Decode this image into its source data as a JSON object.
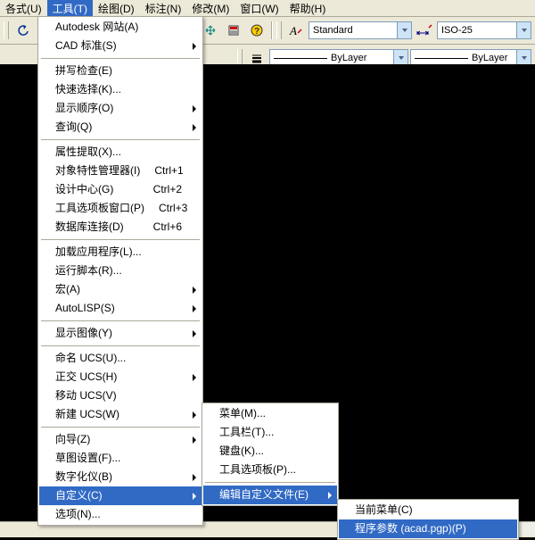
{
  "menubar": {
    "items": [
      "各式(U)",
      "工具(T)",
      "绘图(D)",
      "标注(N)",
      "修改(M)",
      "窗口(W)",
      "帮助(H)"
    ],
    "active_index": 1
  },
  "toolbar1": {
    "style_label": "Standard",
    "dimstyle_label": "ISO-25"
  },
  "toolbar2": {
    "layer_label1": "ByLayer",
    "layer_label2": "ByLayer"
  },
  "tools_menu": [
    {
      "label": "Autodesk 网站(A)"
    },
    {
      "label": "CAD 标准(S)",
      "sub": true
    },
    {
      "sep": true
    },
    {
      "label": "拼写检查(E)"
    },
    {
      "label": "快速选择(K)..."
    },
    {
      "label": "显示顺序(O)",
      "sub": true
    },
    {
      "label": "查询(Q)",
      "sub": true
    },
    {
      "sep": true
    },
    {
      "label": "属性提取(X)..."
    },
    {
      "label": "对象特性管理器(I)",
      "accel": "Ctrl+1"
    },
    {
      "label": "设计中心(G)",
      "accel": "Ctrl+2"
    },
    {
      "label": "工具选项板窗口(P)",
      "accel": "Ctrl+3"
    },
    {
      "label": "数据库连接(D)",
      "accel": "Ctrl+6"
    },
    {
      "sep": true
    },
    {
      "label": "加载应用程序(L)..."
    },
    {
      "label": "运行脚本(R)..."
    },
    {
      "label": "宏(A)",
      "sub": true
    },
    {
      "label": "AutoLISP(S)",
      "sub": true
    },
    {
      "sep": true
    },
    {
      "label": "显示图像(Y)",
      "sub": true
    },
    {
      "sep": true
    },
    {
      "label": "命名 UCS(U)..."
    },
    {
      "label": "正交 UCS(H)",
      "sub": true
    },
    {
      "label": "移动 UCS(V)"
    },
    {
      "label": "新建 UCS(W)",
      "sub": true
    },
    {
      "sep": true
    },
    {
      "label": "向导(Z)",
      "sub": true
    },
    {
      "label": "草图设置(F)..."
    },
    {
      "label": "数字化仪(B)",
      "sub": true
    },
    {
      "label": "自定义(C)",
      "sub": true,
      "hl": true
    },
    {
      "label": "选项(N)..."
    }
  ],
  "customize_submenu": [
    {
      "label": "菜单(M)..."
    },
    {
      "label": "工具栏(T)..."
    },
    {
      "label": "键盘(K)..."
    },
    {
      "label": "工具选项板(P)..."
    },
    {
      "sep": true
    },
    {
      "label": "编辑自定义文件(E)",
      "sub": true,
      "hl": true
    }
  ],
  "edit_custom_submenu": [
    {
      "label": "当前菜单(C)"
    },
    {
      "label": "程序参数 (acad.pgp)(P)",
      "hl": true
    }
  ]
}
